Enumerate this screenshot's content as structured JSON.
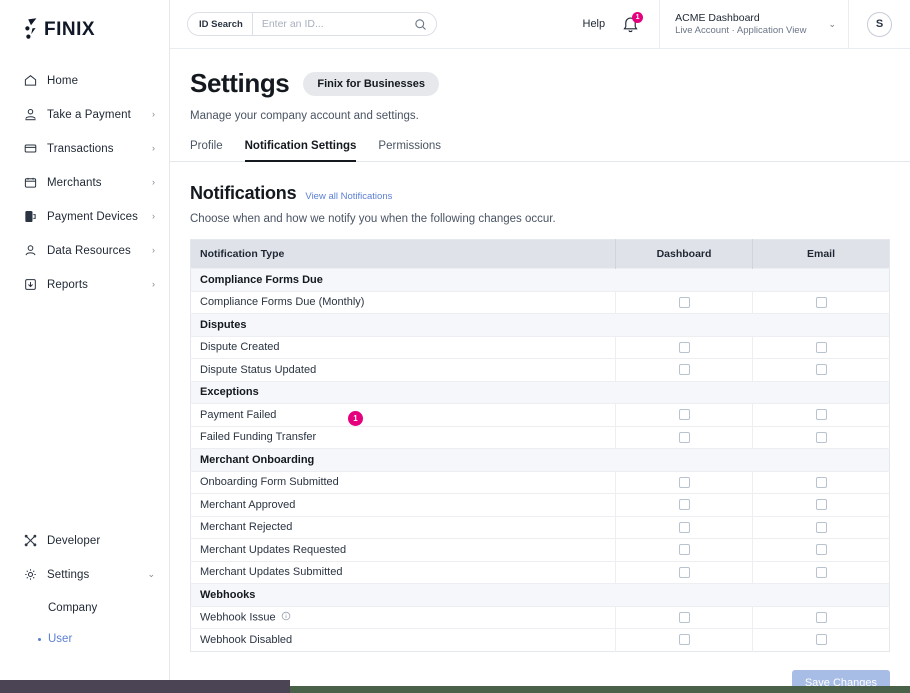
{
  "brand": {
    "logo_text": "FINIX",
    "accent": "#e6007e",
    "link_color": "#5b7fd4"
  },
  "sidebar": {
    "top_items": [
      {
        "label": "Home",
        "icon": "home-icon",
        "chevron": ""
      },
      {
        "label": "Take a Payment",
        "icon": "payment-icon",
        "chevron": "›"
      },
      {
        "label": "Transactions",
        "icon": "transactions-icon",
        "chevron": "›"
      },
      {
        "label": "Merchants",
        "icon": "merchants-icon",
        "chevron": "›"
      },
      {
        "label": "Payment Devices",
        "icon": "device-icon",
        "chevron": "›"
      },
      {
        "label": "Data Resources",
        "icon": "person-icon",
        "chevron": "›"
      },
      {
        "label": "Reports",
        "icon": "reports-icon",
        "chevron": "›"
      }
    ],
    "bottom_items": [
      {
        "label": "Developer",
        "icon": "developer-icon",
        "chevron": ""
      },
      {
        "label": "Settings",
        "icon": "gear-icon",
        "chevron": "⌄"
      }
    ],
    "sub_items": [
      {
        "label": "Company",
        "active": false
      },
      {
        "label": "User",
        "active": true
      }
    ]
  },
  "topbar": {
    "search_tag": "ID Search",
    "search_value": "",
    "search_placeholder": "Enter an ID...",
    "help_label": "Help",
    "bell_badge": "1",
    "account_title": "ACME Dashboard",
    "account_subtitle": "Live Account · Application View",
    "account_chevron": "⌄",
    "avatar_initial": "S"
  },
  "page": {
    "title": "Settings",
    "pill": "Finix for Businesses",
    "subtitle": "Manage your company account and settings.",
    "tabs": [
      {
        "label": "Profile",
        "active": false
      },
      {
        "label": "Notification Settings",
        "active": true
      },
      {
        "label": "Permissions",
        "active": false
      }
    ],
    "section_title": "Notifications",
    "section_link": "View all Notifications",
    "section_subtitle": "Choose when and how we notify you when the following changes occur.",
    "save_label": "Save Changes"
  },
  "table": {
    "columns": [
      "Notification Type",
      "Dashboard",
      "Email"
    ],
    "rows": [
      {
        "type": "group",
        "label": "Compliance Forms Due"
      },
      {
        "type": "item",
        "label": "Compliance Forms Due (Monthly)",
        "dashboard": false,
        "email": false
      },
      {
        "type": "group",
        "label": "Disputes"
      },
      {
        "type": "item",
        "label": "Dispute Created",
        "dashboard": false,
        "email": false
      },
      {
        "type": "item",
        "label": "Dispute Status Updated",
        "dashboard": false,
        "email": false
      },
      {
        "type": "group",
        "label": "Exceptions"
      },
      {
        "type": "item",
        "label": "Payment Failed",
        "dashboard": false,
        "email": false
      },
      {
        "type": "item",
        "label": "Failed Funding Transfer",
        "dashboard": false,
        "email": false
      },
      {
        "type": "group",
        "label": "Merchant Onboarding"
      },
      {
        "type": "item",
        "label": "Onboarding Form Submitted",
        "dashboard": false,
        "email": false
      },
      {
        "type": "item",
        "label": "Merchant Approved",
        "dashboard": false,
        "email": false
      },
      {
        "type": "item",
        "label": "Merchant Rejected",
        "dashboard": false,
        "email": false
      },
      {
        "type": "item",
        "label": "Merchant Updates Requested",
        "dashboard": false,
        "email": false
      },
      {
        "type": "item",
        "label": "Merchant Updates Submitted",
        "dashboard": false,
        "email": false
      },
      {
        "type": "group",
        "label": "Webhooks"
      },
      {
        "type": "item",
        "label": "Webhook Issue",
        "info": true,
        "dashboard": false,
        "email": false
      },
      {
        "type": "item",
        "label": "Webhook Disabled",
        "dashboard": false,
        "email": false
      }
    ]
  },
  "annotation": {
    "marker_label": "1"
  }
}
